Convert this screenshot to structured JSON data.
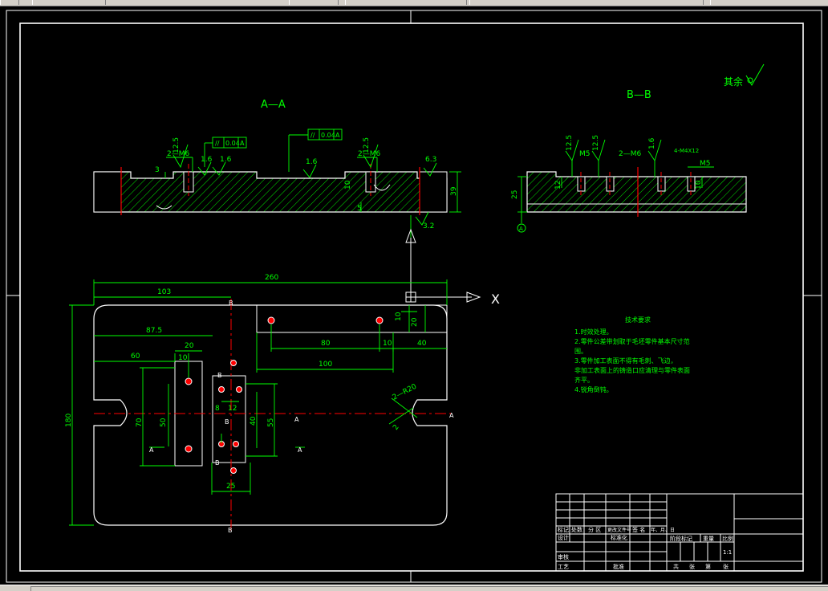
{
  "colors": {
    "background": "#000000",
    "outline": "#ffffff",
    "dimension": "#00ff00",
    "hatch": "#00ff00",
    "centerline": "#ff0000",
    "hole_fill": "#ff0000",
    "note_text": "#00ff00"
  },
  "views": {
    "section_aa": {
      "title": "A—A",
      "roughness": [
        "12.5",
        "1.6",
        "1.6",
        "1.6",
        "12.5",
        "6.3",
        "3.2"
      ],
      "labels": {
        "thread_left": "2—M6",
        "thread_right": "2—M6",
        "dim_3": "3",
        "dim_39": "39",
        "dim_5": "5",
        "dim_10": "10"
      },
      "tolerance_frames": [
        {
          "symbol": "//",
          "value": "0.04",
          "datum": "A"
        },
        {
          "symbol": "//",
          "value": "0.04",
          "datum": "A"
        }
      ]
    },
    "section_bb": {
      "title": "B—B",
      "roughness": [
        "12.5",
        "12.5",
        "1.6"
      ],
      "labels": {
        "m5_left": "M5",
        "thread": "2—M6",
        "m5_right": "M5",
        "m4x12": "4-M4X12",
        "dim_25": "25",
        "dim_12": "12",
        "dim_10": "10",
        "datum": "A"
      }
    },
    "plan": {
      "dims": {
        "d260": "260",
        "d103": "103",
        "d87_5": "87.5",
        "d20": "20",
        "d60": "60",
        "d10a": "10",
        "d180": "180",
        "d70": "70",
        "d50": "50",
        "d8": "8",
        "d12": "12",
        "d40": "40",
        "d55": "55",
        "d25": "25",
        "d80": "80",
        "d10b": "10",
        "d40b": "40",
        "d100": "100",
        "d10c": "10",
        "d20b": "20",
        "r20": "2—R20",
        "r2": "2"
      },
      "section_marks": {
        "a": "A",
        "b": "B"
      }
    }
  },
  "ucs": {
    "x_label": "X"
  },
  "surface_finish_note": "其余",
  "technical_requirements": {
    "title": "技术要求",
    "lines": [
      "1.时效处理。",
      "2.零件公差带划取于毛坯零件基本尺寸范",
      "围。",
      "3.零件加工表面不得有毛刺、飞边，",
      "非加工表面上的铸造口应清理与零件表面",
      "齐平。",
      "4.锐角倒钝。"
    ]
  },
  "title_block": {
    "row1": [
      "标记",
      "处数",
      "分 区",
      "更改文件号",
      "签 名",
      "年、月、日"
    ],
    "row2": [
      "设计",
      "",
      "",
      "标准化",
      "",
      ""
    ],
    "row3": [
      "审核",
      "",
      "",
      "",
      "",
      ""
    ],
    "row4": [
      "工艺",
      "",
      "",
      "批准",
      "",
      ""
    ],
    "right_header": [
      "阶段标记",
      "重量",
      "比例"
    ],
    "scale": "1:1",
    "sheets": [
      "共",
      "张",
      "第",
      "张"
    ]
  }
}
